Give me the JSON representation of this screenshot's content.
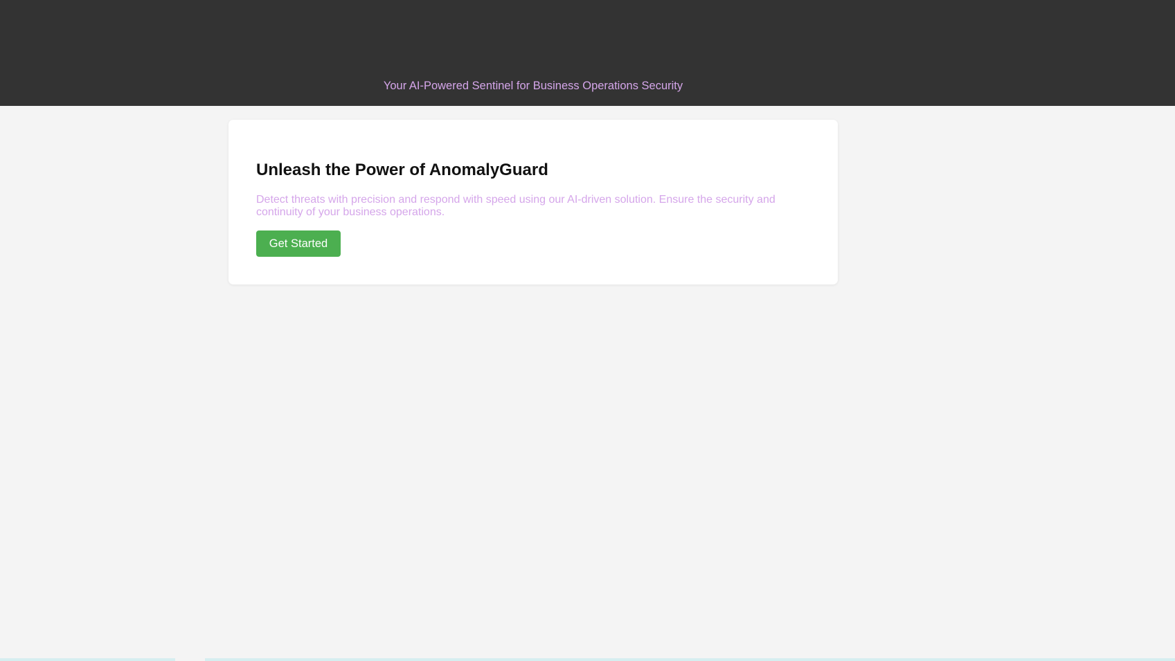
{
  "header": {
    "tagline": "Your AI-Powered Sentinel for Business Operations Security",
    "background_color": "#333333",
    "tagline_color": "#d5a6ea"
  },
  "hero_card": {
    "title": "Unleash the Power of AnomalyGuard",
    "description": "Detect threats with precision and respond with speed using our AI-driven solution. Ensure the security and continuity of your business operations.",
    "cta_label": "Get Started",
    "cta_color": "#4caf50"
  },
  "page": {
    "background_color": "#f4f4f4"
  }
}
